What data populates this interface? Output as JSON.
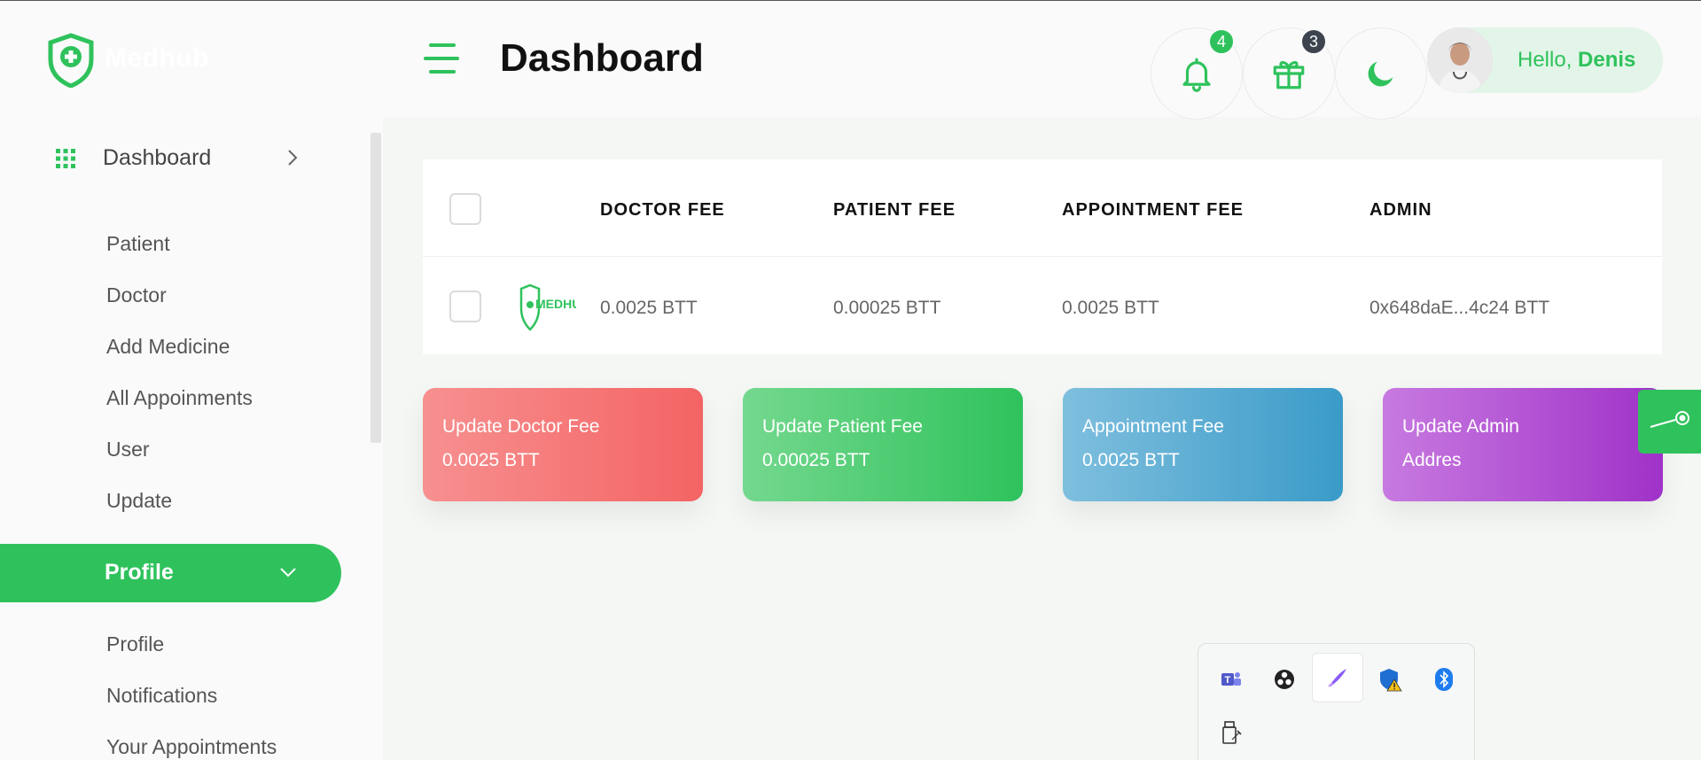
{
  "app": {
    "logo_text": "Medhub",
    "page_title": "Dashboard"
  },
  "header": {
    "notifications_count": "4",
    "gifts_count": "3",
    "greeting": "Hello,",
    "user_name": "Denis"
  },
  "sidebar": {
    "main_item": "Dashboard",
    "dashboard_items": [
      "Patient",
      "Doctor",
      "Add Medicine",
      "All Appoinments",
      "User",
      "Update"
    ],
    "profile_section": "Profile",
    "profile_items": [
      "Profile",
      "Notifications",
      "Your Appointments"
    ]
  },
  "table": {
    "headers": [
      "DOCTOR FEE",
      "PATIENT FEE",
      "APPOINTMENT FEE",
      "ADMIN"
    ],
    "row_logo_text": "MEDHUB",
    "row": [
      "0.0025 BTT",
      "0.00025 BTT",
      "0.0025 BTT",
      "0x648daE...4c24 BTT"
    ]
  },
  "cards": [
    {
      "title": "Update Doctor Fee",
      "value": "0.0025 BTT"
    },
    {
      "title": "Update Patient Fee",
      "value": "0.00025 BTT"
    },
    {
      "title": "Appointment Fee",
      "value": "0.0025 BTT"
    },
    {
      "title": "Update Admin",
      "value": "Addres"
    }
  ],
  "colors": {
    "accent": "#2fc25c",
    "card_red": "#f46464",
    "card_green": "#2fc25c",
    "card_blue": "#3a9bc8",
    "card_purple": "#a032c8"
  },
  "tray_icons": [
    "teams-icon",
    "obs-icon",
    "pen-icon",
    "defender-warning-icon",
    "bluetooth-icon",
    "usb-drive-icon"
  ]
}
